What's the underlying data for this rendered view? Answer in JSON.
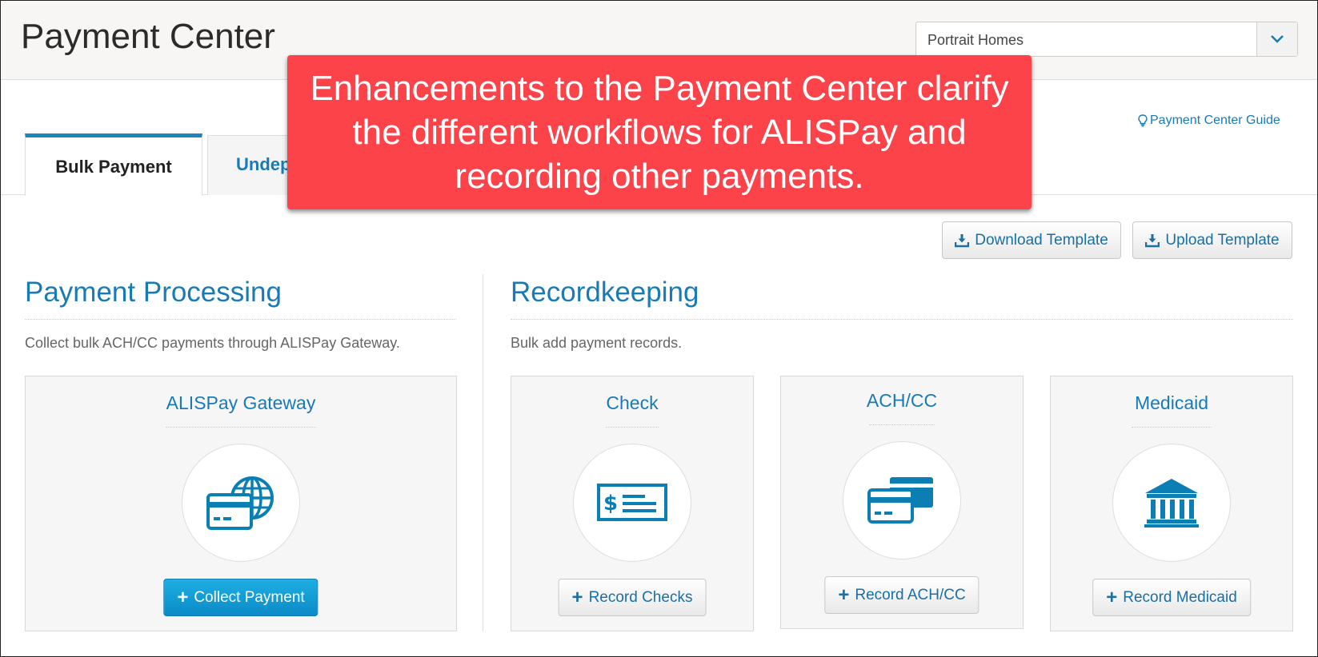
{
  "header": {
    "title": "Payment Center",
    "community_select": {
      "value": "Portrait Homes"
    }
  },
  "guide_link": {
    "label": "Payment Center Guide"
  },
  "tabs": [
    {
      "label": "Bulk Payment",
      "active": true
    },
    {
      "label": "Undep",
      "active": false
    }
  ],
  "toolbar": {
    "download_label": "Download Template",
    "upload_label": "Upload Template"
  },
  "processing": {
    "title": "Payment Processing",
    "description": "Collect bulk ACH/CC payments through ALISPay Gateway.",
    "card": {
      "title": "ALISPay Gateway",
      "button": "Collect Payment",
      "icon": "credit-card-globe-icon"
    }
  },
  "recordkeeping": {
    "title": "Recordkeeping",
    "description": "Bulk add payment records.",
    "cards": [
      {
        "title": "Check",
        "button": "Record Checks",
        "icon": "check-icon"
      },
      {
        "title": "ACH/CC",
        "button": "Record ACH/CC",
        "icon": "credit-cards-icon"
      },
      {
        "title": "Medicaid",
        "button": "Record Medicaid",
        "icon": "bank-icon"
      }
    ]
  },
  "callout": {
    "text": "Enhancements to the Payment Center clarify the different workflows for ALISPay and recording other payments."
  },
  "colors": {
    "accent": "#1a7ab5",
    "primary_button": "#0b8bc7",
    "callout": "#fc4349",
    "icon": "#0b7fb3"
  }
}
